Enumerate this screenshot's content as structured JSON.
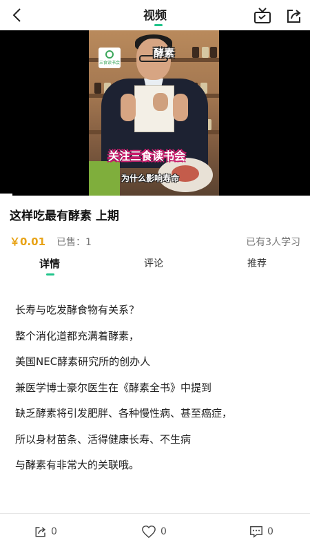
{
  "header": {
    "title": "视频"
  },
  "video": {
    "logo_text": "三食读书会",
    "caption_top": "酵素",
    "caption_follow": "关注三食读书会",
    "caption_bottom": "为什么影响寿命"
  },
  "course": {
    "title": "这样吃最有酵素 上期",
    "price": "￥0.01",
    "sold": "已售：1",
    "learners": "已有3人学习"
  },
  "tabs": [
    {
      "label": "详情",
      "active": true
    },
    {
      "label": "评论",
      "active": false
    },
    {
      "label": "推荐",
      "active": false
    }
  ],
  "description": [
    "长寿与吃发酵食物有关系？",
    "整个消化道都充满着酵素，",
    "美国NEC酵素研究所的创办人",
    "兼医学博士豪尔医生在《酵素全书》中提到",
    "缺乏酵素将引发肥胖、各种慢性病、甚至癌症，",
    "所以身材苗条、活得健康长寿、不生病",
    "与酵素有非常大的关联哦。"
  ],
  "bottom_bar": {
    "share_count": "0",
    "like_count": "0",
    "comment_count": "0"
  },
  "colors": {
    "accent": "#1fc48a",
    "price": "#e8a317"
  }
}
